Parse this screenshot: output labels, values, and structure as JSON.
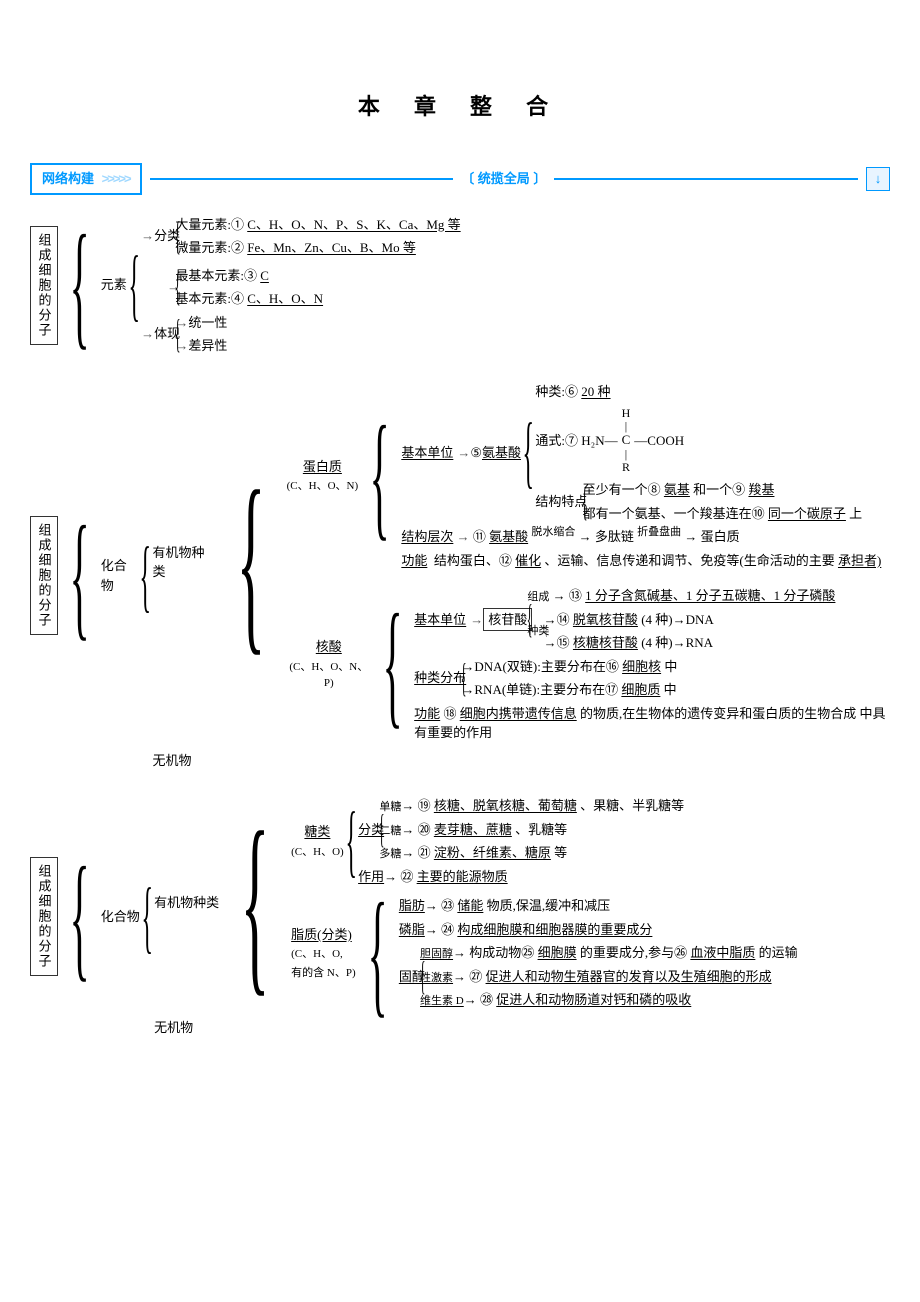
{
  "title": "本 章 整 合",
  "section_bar": {
    "label": "网络构建",
    "chevron": ">>>>>",
    "bracket": "〔 统揽全局 〕",
    "down_icon": "↓"
  },
  "common": {
    "root": "组成细胞的分子",
    "elements": "元素",
    "classify": "分类",
    "embody": "体现",
    "compound": "化合物",
    "organic_types": "有机物种类",
    "inorganic": "无机物",
    "arrow": "→"
  },
  "sec1": {
    "macro_label": "大量元素:①",
    "macro_val": "C、H、O、N、P、S、K、Ca、Mg 等",
    "micro_label": "微量元素:②",
    "micro_val": "Fe、Mn、Zn、Cu、B、Mo 等",
    "most_basic_label": "最基本元素:③",
    "most_basic_val": "C",
    "basic_label": "基本元素:④",
    "basic_val": "C、H、O、N",
    "unity": "统一性",
    "diff": "差异性"
  },
  "sec2": {
    "protein_label": "蛋白质",
    "protein_elem": "(C、H、O、N)",
    "nucleic_label": "核酸",
    "nucleic_elem": "(C、H、O、N、P)",
    "basic_unit": "基本单位",
    "aa_num": "⑤",
    "aa_val": "氨基酸",
    "kinds_label": "种类:⑥",
    "kinds_val": "20 种",
    "general_label": "通式:⑦",
    "formula_left": "H₂N",
    "formula_mid": "C",
    "formula_top": "H",
    "formula_bot": "R",
    "formula_right": "COOH",
    "struct_label": "结构特点",
    "struct_line1a": "至少有一个⑧",
    "struct_line1b": "氨基",
    "struct_line1c": "和一个⑨",
    "struct_line1d": "羧基",
    "struct_line2a": "都有一个氨基、一个羧基连在⑩",
    "struct_line2b": "同一个碳原子",
    "struct_line2c": "上",
    "levels_label": "结构层次",
    "levels_num": "⑪",
    "levels_1": "氨基酸",
    "levels_arrow1": "脱水缩合",
    "levels_2": "多肽链",
    "levels_arrow2": "折叠盘曲",
    "levels_3": "蛋白质",
    "func_label": "功能",
    "func_text1": "结构蛋白、⑫",
    "func_text1u": "催化",
    "func_text2": "、运输、信息传递和调节、免疫等(生命活动的主要",
    "func_text3": "承担者)",
    "nt_label": "核苷酸",
    "nt_comp_label": "组成",
    "nt_comp_num": "⑬",
    "nt_comp_val": "1 分子含氮碱基、1 分子五碳糖、1 分子磷酸",
    "nt_kind_label": "种类",
    "nt_kind1_num": "⑭",
    "nt_kind1_val": "脱氧核苷酸",
    "nt_kind1_tail": "(4 种)→DNA",
    "nt_kind2_num": "⑮",
    "nt_kind2_val": "核糖核苷酸",
    "nt_kind2_tail": "(4 种)→RNA",
    "dist_label": "种类分布",
    "dist_dna": "DNA(双链):主要分布在⑯",
    "dist_dna_val": "细胞核",
    "dist_dna_tail": "中",
    "dist_rna": "RNA(单链):主要分布在⑰",
    "dist_rna_val": "细胞质",
    "dist_rna_tail": "中",
    "nfunc_num": "⑱",
    "nfunc_text1": "细胞内携带遗传信息",
    "nfunc_text2": "的物质,在生物体的遗传变异和蛋白质的生物合成",
    "nfunc_text3": "中具有重要的作用"
  },
  "sec3": {
    "sugar_label": "糖类",
    "sugar_elem": "(C、H、O)",
    "lipid_label": "脂质(分类)",
    "lipid_elem1": "(C、H、O,",
    "lipid_elem2": "有的含 N、P)",
    "mono_label": "单糖",
    "mono_num": "⑲",
    "mono_val": "核糖、脱氧核糖、葡萄糖",
    "mono_tail": "、果糖、半乳糖等",
    "di_label": "二糖",
    "di_num": "⑳",
    "di_val": "麦芽糖、蔗糖",
    "di_tail": "、乳糖等",
    "poly_label": "多糖",
    "poly_num": "㉑",
    "poly_val": "淀粉、纤维素、糖原",
    "poly_tail": "等",
    "sugar_func_label": "作用",
    "sugar_func_num": "㉒",
    "sugar_func_val": "主要的能源物质",
    "fat_label": "脂肪",
    "fat_num": "㉓",
    "fat_val": "储能",
    "fat_tail": "物质,保温,缓冲和减压",
    "phos_label": "磷脂",
    "phos_num": "㉔",
    "phos_val": "构成细胞膜和细胞器膜的重要成分",
    "sterol_label": "固醇",
    "chol_label": "胆固醇",
    "chol_text1": "构成动物㉕",
    "chol_text1u": "细胞膜",
    "chol_text2": "的重要成分,参与㉖",
    "chol_text2u": "血液中脂质",
    "chol_text3": "的运输",
    "sexh_label": "性激素",
    "sexh_num": "㉗",
    "sexh_val": "促进人和动物生殖器官的发育以及生殖细胞的形成",
    "vitd_label": "维生素 D",
    "vitd_num": "㉘",
    "vitd_val": "促进人和动物肠道对钙和磷的吸收"
  }
}
